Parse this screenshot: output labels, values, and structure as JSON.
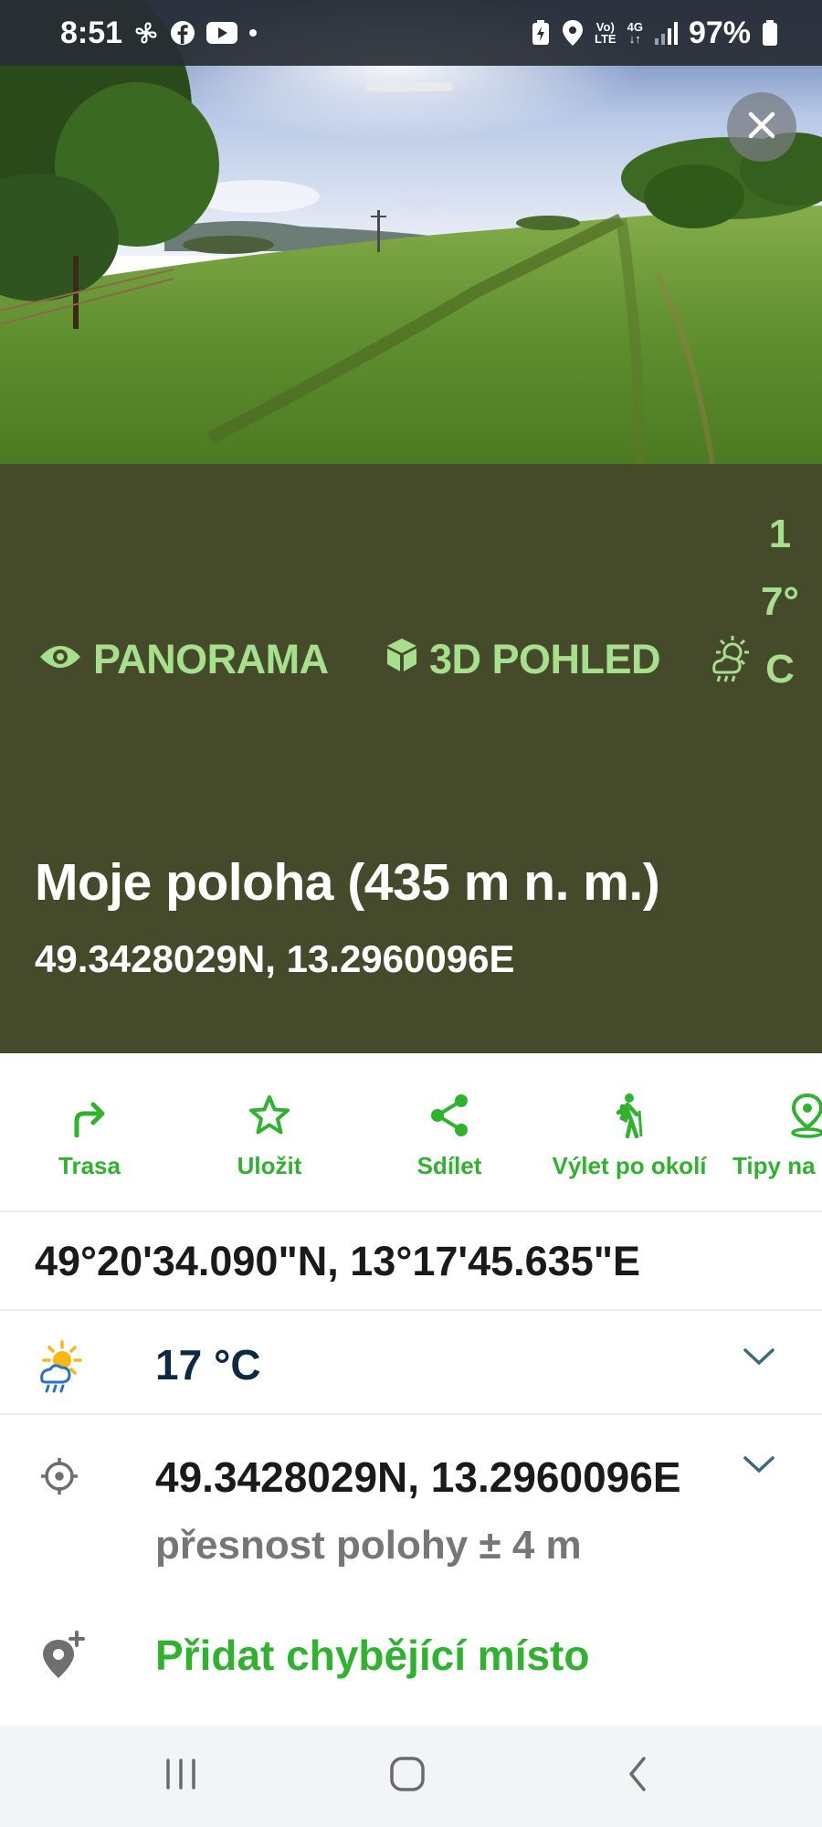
{
  "status_bar": {
    "time": "8:51",
    "battery": "97%",
    "network_volte": "Vo)\nLTE",
    "network_4g": "4G"
  },
  "photo": {
    "close_icon": "close-icon"
  },
  "panel": {
    "panorama_label": "PANORAMA",
    "view3d_label": "3D POHLED",
    "temperature_vertical": "17°C",
    "title": "Moje poloha (435 m n. m.)",
    "coords": "49.3428029N, 13.2960096E",
    "accent_color": "#a6e08c",
    "background_color": "#454a2a"
  },
  "actions": [
    {
      "label": "Trasa",
      "icon": "route-turn-icon"
    },
    {
      "label": "Uložit",
      "icon": "star-icon"
    },
    {
      "label": "Sdílet",
      "icon": "share-icon"
    },
    {
      "label": "Výlet po okolí",
      "icon": "hiker-icon"
    },
    {
      "label": "Tipy na",
      "icon": "map-pin-icon"
    }
  ],
  "dms": "49°20'34.090\"N, 13°17'45.635\"E",
  "weather": {
    "temperature": "17 °C",
    "icon": "partly-cloudy-rain-icon"
  },
  "location": {
    "coords": "49.3428029N, 13.2960096E",
    "accuracy": "přesnost polohy ± 4 m",
    "icon": "crosshair-icon"
  },
  "add_place": {
    "label": "Přidat chybějící místo",
    "icon": "pin-plus-icon"
  },
  "brand_green": "#2fb32f"
}
